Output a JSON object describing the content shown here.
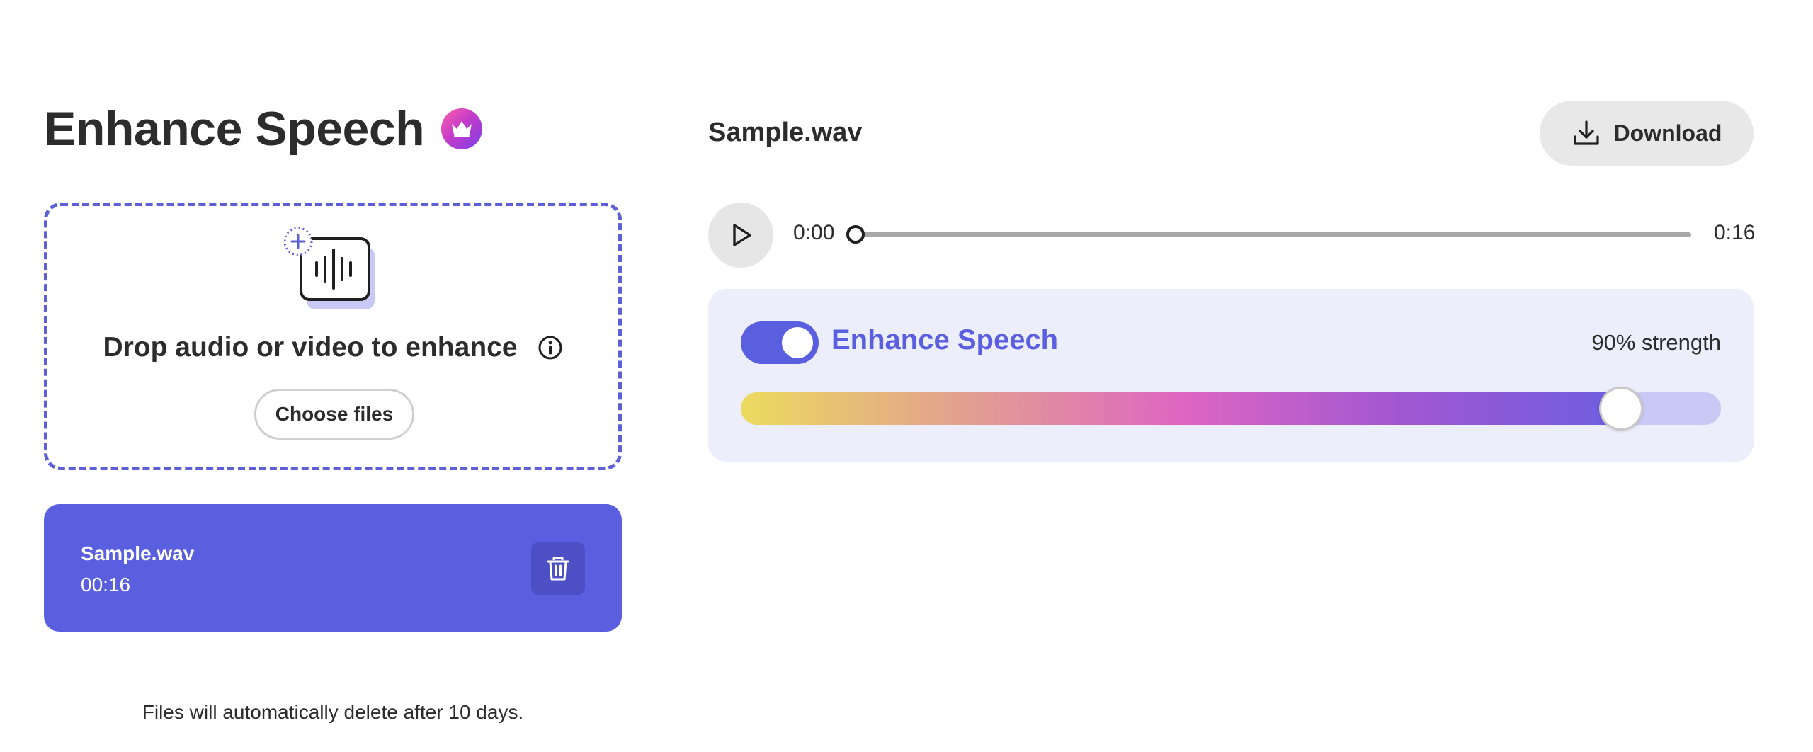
{
  "header": {
    "title": "Enhance Speech",
    "badge_icon": "crown-icon"
  },
  "dropzone": {
    "title": "Drop audio or video to enhance",
    "choose_label": "Choose files",
    "accent": "#5c5fd6"
  },
  "file": {
    "name": "Sample.wav",
    "duration": "00:16",
    "delete_icon": "trash-icon"
  },
  "footnote": "Files will automatically delete after 10 days.",
  "player": {
    "title": "Sample.wav",
    "download_label": "Download",
    "time_current": "0:00",
    "time_total": "0:16",
    "progress": 0
  },
  "enhance": {
    "label": "Enhance Speech",
    "enabled": true,
    "strength_label": "90% strength",
    "strength": 0.9,
    "accent": "#5a5fdf"
  }
}
